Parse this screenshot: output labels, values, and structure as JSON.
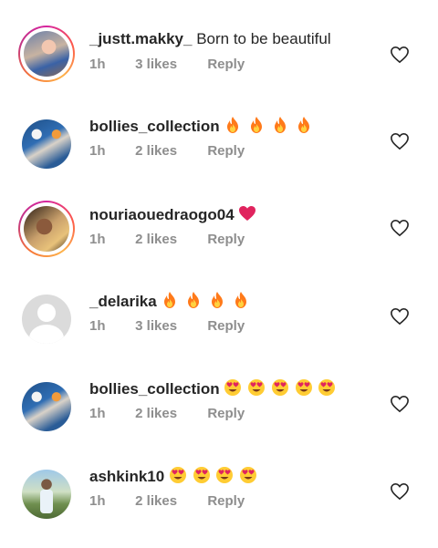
{
  "comments": [
    {
      "username": "_justt.makky_",
      "text": "Born to be beautiful",
      "emoji": [],
      "time": "1h",
      "likes": "3 likes",
      "reply": "Reply",
      "avatar": "photo-ring"
    },
    {
      "username": "bollies_collection",
      "text": "",
      "emoji": [
        "fire",
        "fire",
        "fire",
        "fire"
      ],
      "time": "1h",
      "likes": "2 likes",
      "reply": "Reply",
      "avatar": "photo"
    },
    {
      "username": "nouriaouedraogo04",
      "text": "",
      "emoji": [
        "red-heart"
      ],
      "time": "1h",
      "likes": "2 likes",
      "reply": "Reply",
      "avatar": "photo-ring"
    },
    {
      "username": "_delarika",
      "text": "",
      "emoji": [
        "fire",
        "fire",
        "fire",
        "fire"
      ],
      "time": "1h",
      "likes": "3 likes",
      "reply": "Reply",
      "avatar": "default"
    },
    {
      "username": "bollies_collection",
      "text": "",
      "emoji": [
        "heart-eyes",
        "heart-eyes",
        "heart-eyes",
        "heart-eyes",
        "heart-eyes"
      ],
      "time": "1h",
      "likes": "2 likes",
      "reply": "Reply",
      "avatar": "photo"
    },
    {
      "username": "ashkink10",
      "text": "",
      "emoji": [
        "heart-eyes",
        "heart-eyes",
        "heart-eyes",
        "heart-eyes"
      ],
      "time": "1h",
      "likes": "2 likes",
      "reply": "Reply",
      "avatar": "photo"
    }
  ],
  "colors": {
    "meta_gray": "#8e8e8e",
    "text": "#262626",
    "fire": "#ff7a1a",
    "heart": "#e0245e"
  },
  "icons": {
    "like": "heart-outline-icon",
    "avatar_default": "default-avatar-icon"
  }
}
